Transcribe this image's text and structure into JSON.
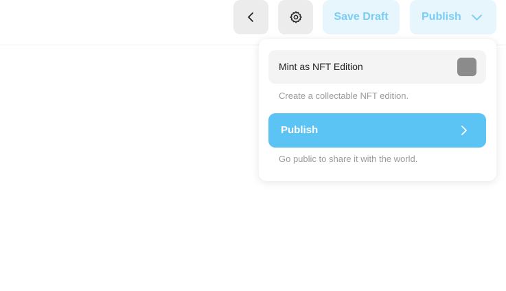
{
  "toolbar": {
    "back_icon": "chevron-left-icon",
    "settings_icon": "gear-icon",
    "save_draft_label": "Save Draft",
    "publish_label": "Publish",
    "publish_dropdown_icon": "chevron-down-icon"
  },
  "dropdown": {
    "mint_label": "Mint as NFT Edition",
    "mint_toggle_state": "off",
    "mint_description": "Create a collectable NFT edition.",
    "publish_label": "Publish",
    "publish_arrow_icon": "chevron-right-icon",
    "publish_description": "Go public to share it with the world."
  },
  "colors": {
    "accent": "#5bc4f5",
    "accent_light": "#e7f5fd",
    "accent_text": "#79cdf4",
    "neutral_button": "#ececec",
    "toggle_off": "#8b8b8b"
  }
}
